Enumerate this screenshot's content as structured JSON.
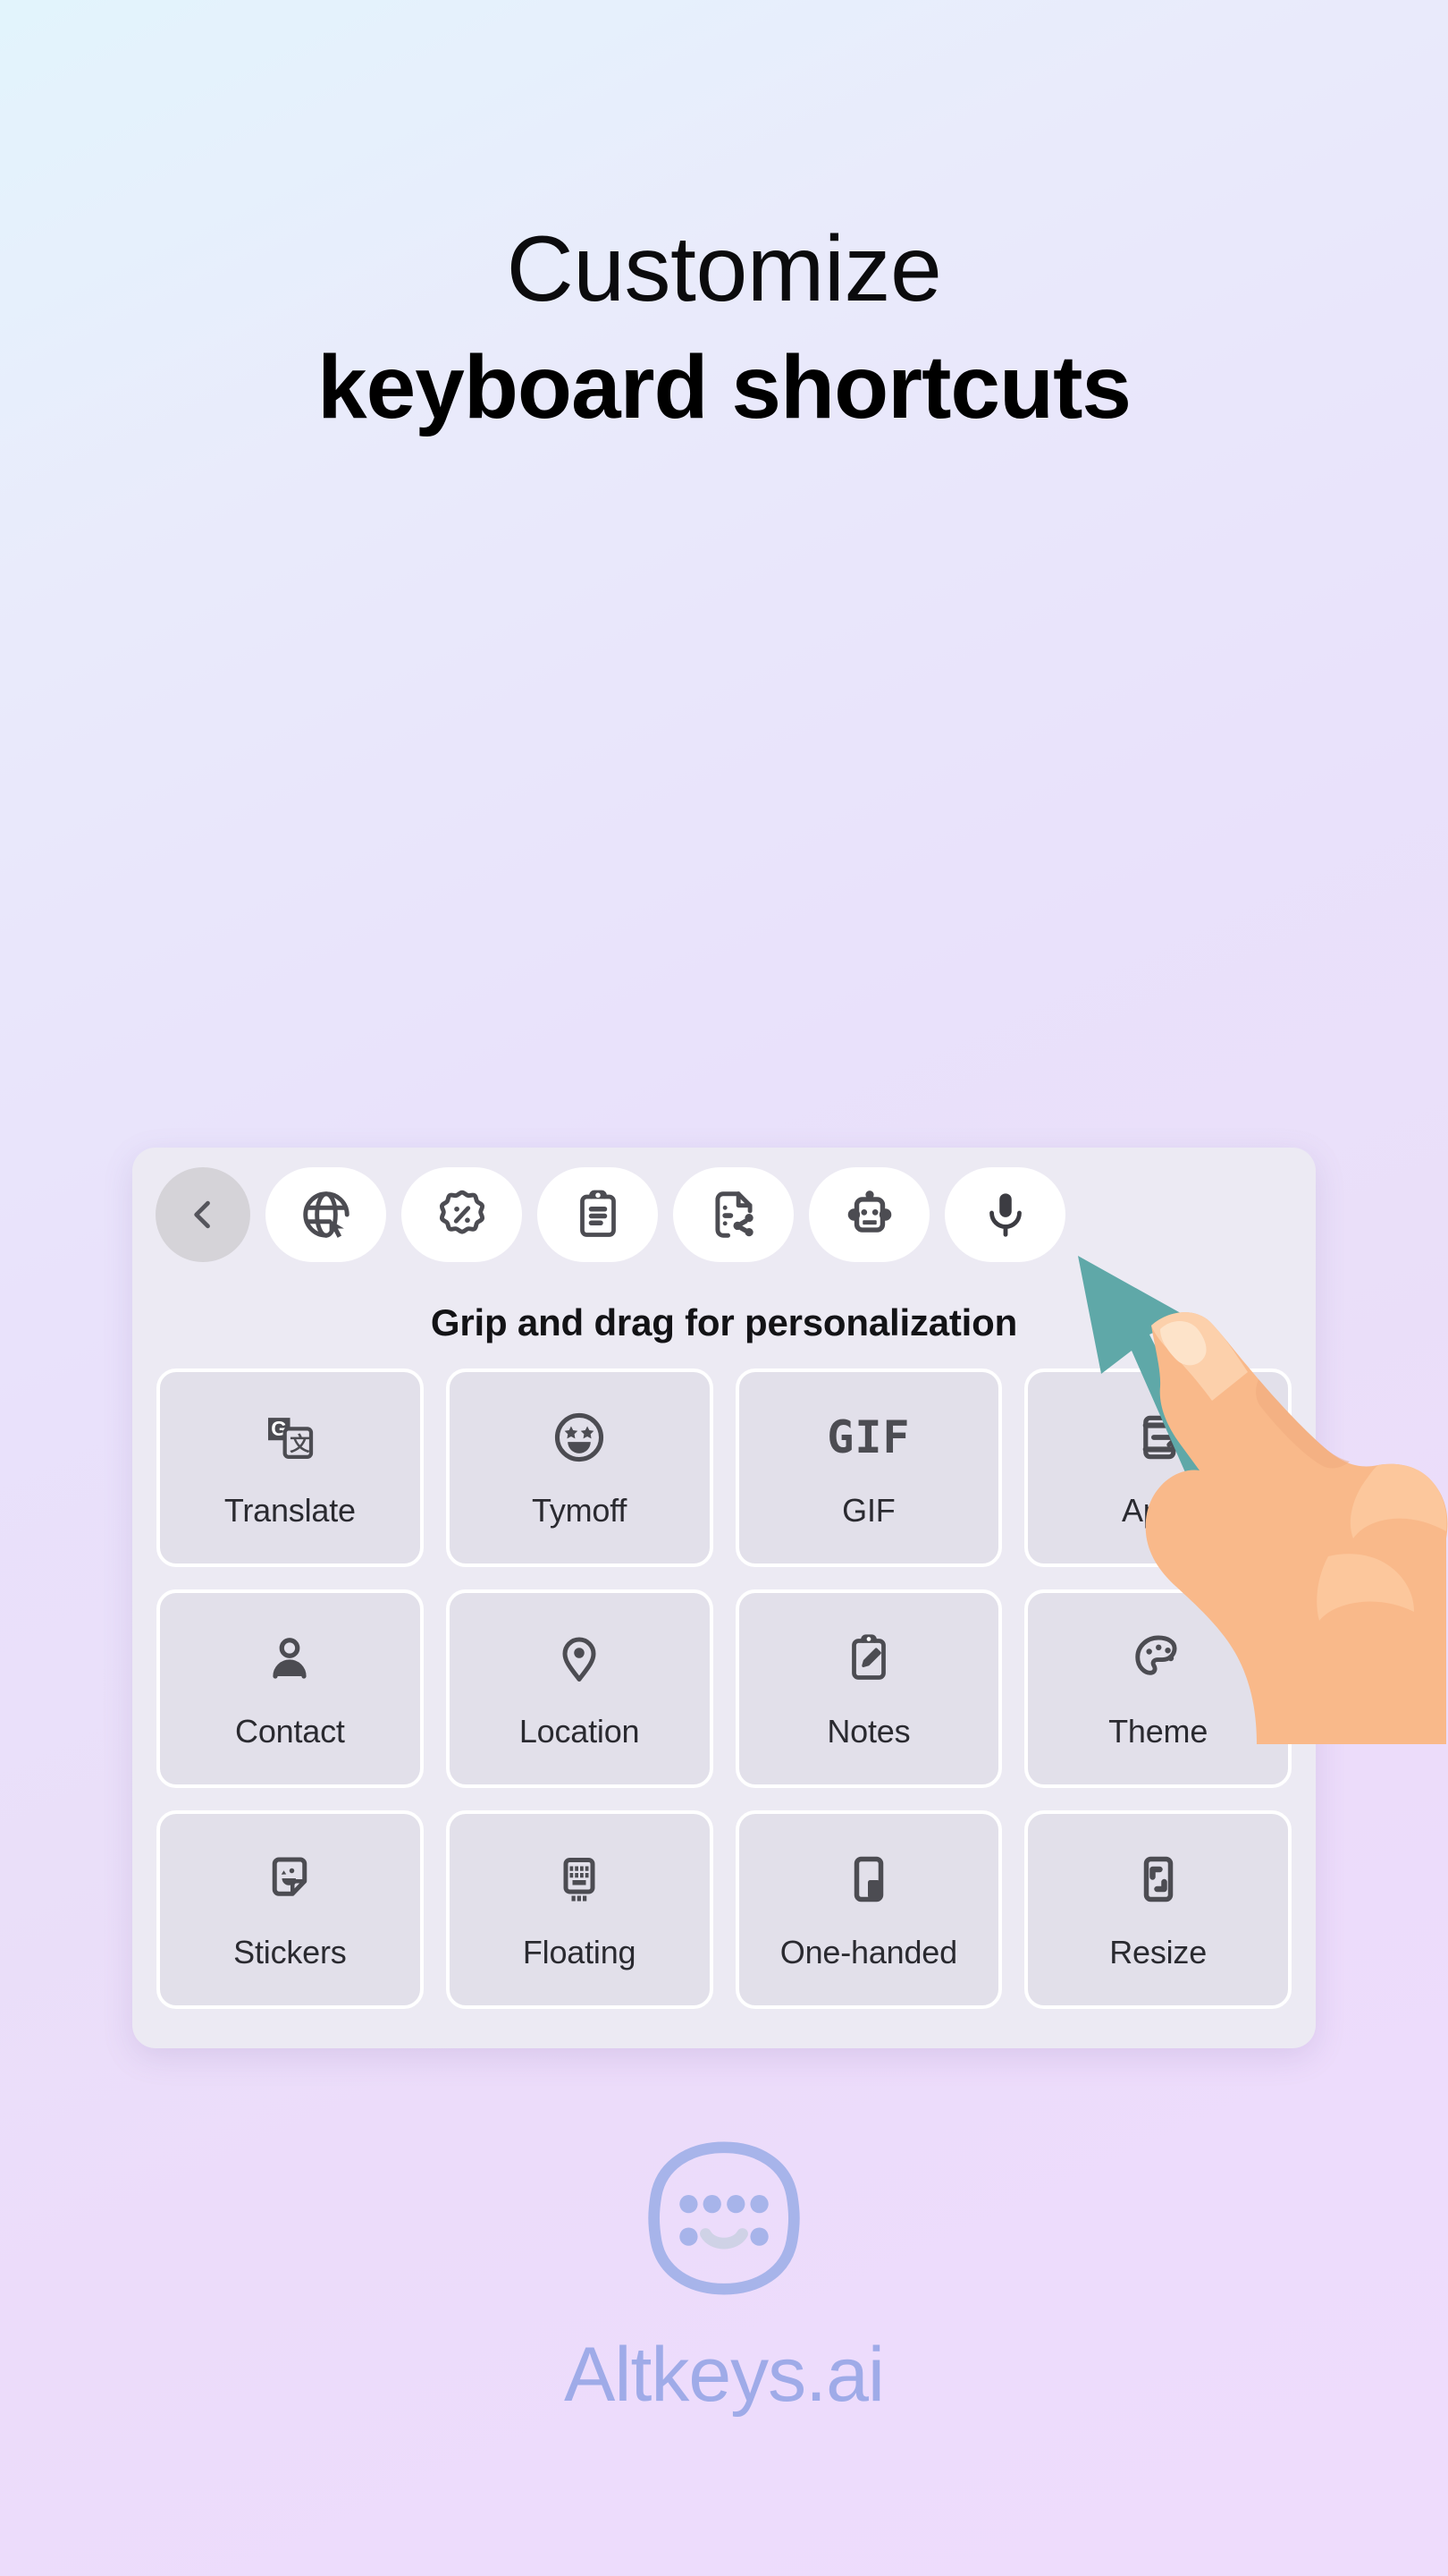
{
  "headline": {
    "line1": "Customize",
    "line2": "keyboard shortcuts"
  },
  "keyboard_card": {
    "hint": "Grip and drag for personalization",
    "toolbar": [
      {
        "name": "back-icon",
        "label": "Back"
      },
      {
        "name": "globe-cursor-icon",
        "label": "Browse"
      },
      {
        "name": "percent-badge-icon",
        "label": "Offers"
      },
      {
        "name": "clipboard-icon",
        "label": "Clipboard"
      },
      {
        "name": "file-share-icon",
        "label": "Share file"
      },
      {
        "name": "robot-icon",
        "label": "AI assistant"
      },
      {
        "name": "microphone-icon",
        "label": "Voice input"
      }
    ],
    "tiles": [
      {
        "label": "Translate",
        "icon": "google-translate-icon"
      },
      {
        "label": "Tymoff",
        "icon": "star-eyes-smiley-icon"
      },
      {
        "label": "GIF",
        "icon": "gif-text-icon"
      },
      {
        "label": "Apps",
        "icon": "phone-arrow-icon"
      },
      {
        "label": "Contact",
        "icon": "person-icon"
      },
      {
        "label": "Location",
        "icon": "map-pin-icon"
      },
      {
        "label": "Notes",
        "icon": "note-pencil-icon"
      },
      {
        "label": "Theme",
        "icon": "palette-icon"
      },
      {
        "label": "Stickers",
        "icon": "sticker-icon"
      },
      {
        "label": "Floating",
        "icon": "floating-keyboard-icon"
      },
      {
        "label": "One-handed",
        "icon": "one-handed-keyboard-icon"
      },
      {
        "label": "Resize",
        "icon": "resize-icon"
      }
    ]
  },
  "pointer": {
    "arrow_icon": "up-left-arrow-icon",
    "hand_icon": "pointing-hand-icon",
    "arrow_color": "#5fa8a8"
  },
  "brand": {
    "logo_icon": "altkeys-smiley-logo",
    "name": "Altkeys.ai",
    "color": "#9fabe8"
  },
  "colors": {
    "background_top": "#e2f4fc",
    "background_bottom": "#eedcfc",
    "card_bg": "#eceaf3",
    "tile_bg": "#e2e0ea",
    "icon_gray": "#4c4c52",
    "accent_teal": "#5fa8a8",
    "brand_blue": "#9fabe8"
  }
}
